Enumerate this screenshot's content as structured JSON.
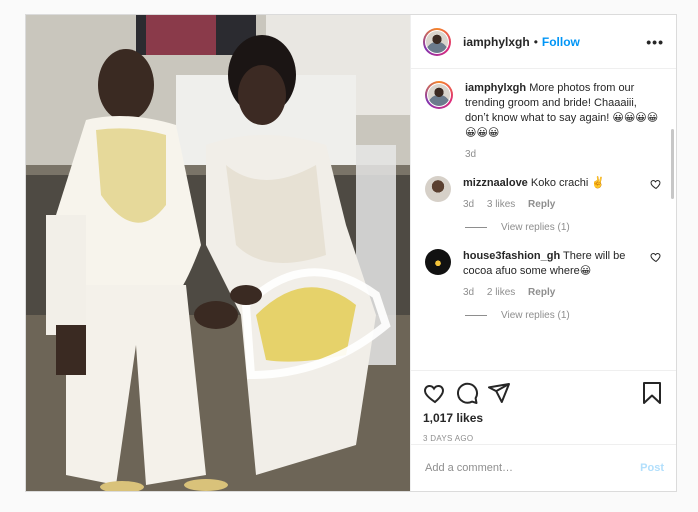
{
  "post": {
    "username": "iamphylxgh",
    "follow_label": "Follow",
    "more_label": "•••",
    "dot": "•",
    "caption": {
      "username": "iamphylxgh",
      "text": "More photos from our trending groom and bride! Chaaaiii, donʼt know what to say again! 😀😀😀😀😀😀😀",
      "time": "3d"
    },
    "comments": [
      {
        "username": "mizznaalove",
        "text": "Koko crachi ✌️",
        "time": "3d",
        "likes": "3 likes",
        "reply": "Reply",
        "view_replies": "View replies (1)"
      },
      {
        "username": "house3fashion_gh",
        "text": "There will be cocoa afuo some where😀",
        "time": "3d",
        "likes": "2 likes",
        "reply": "Reply",
        "view_replies": "View replies (1)"
      }
    ],
    "likes": "1,017 likes",
    "posted": "3 DAYS AGO",
    "add_comment_placeholder": "Add a comment…",
    "post_button": "Post"
  },
  "colors": {
    "accent": "#0095f6",
    "post_disabled": "#b2dffc",
    "muted": "#8e8e8e"
  },
  "icons": [
    "heart-icon",
    "comment-icon",
    "share-icon",
    "bookmark-icon",
    "more-icon"
  ]
}
